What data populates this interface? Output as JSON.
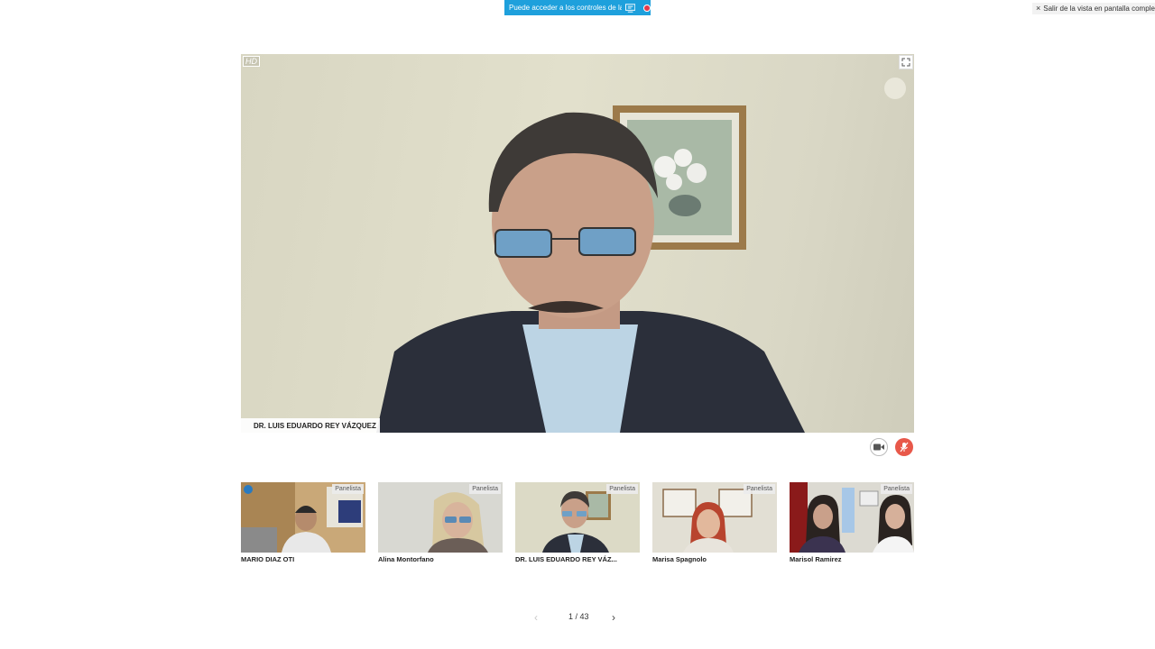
{
  "banner": {
    "text": "Puede acceder a los controles de la...",
    "screen_icon": "screen-share-icon",
    "status_icon": "record-dot-icon"
  },
  "exit_fullscreen": {
    "label": "Salir de la vista en pantalla completa",
    "icon": "close-icon"
  },
  "main_video": {
    "hd_label": "HD",
    "speaker_name": "DR. LUIS EDUARDO REY VÁZQUEZ",
    "expand_icon": "expand-icon"
  },
  "controls": {
    "camera_icon": "camera-icon",
    "mic_icon": "mic-muted-icon",
    "mic_color": "#e8584a"
  },
  "participants": [
    {
      "name": "MARIO DIAZ OTI",
      "role": "Panelista"
    },
    {
      "name": "Alina Montorfano",
      "role": "Panelista"
    },
    {
      "name": "DR. LUIS EDUARDO REY VÁZ...",
      "role": "Panelista"
    },
    {
      "name": "Marisa Spagnolo",
      "role": "Panelista"
    },
    {
      "name": "Marisol Ramirez",
      "role": "Panelista"
    }
  ],
  "pagination": {
    "label": "1 / 43",
    "prev_icon": "chevron-left-icon",
    "next_icon": "chevron-right-icon"
  },
  "colors": {
    "accent": "#1ea0dc",
    "muted_red": "#e8584a"
  }
}
